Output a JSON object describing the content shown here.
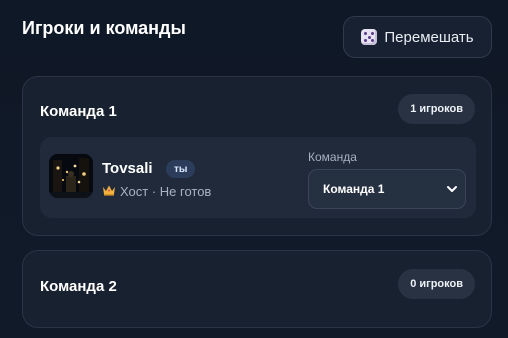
{
  "header": {
    "title": "Игроки и команды",
    "shuffle_label": "Перемешать",
    "shuffle_icon": "dice-icon"
  },
  "teams": [
    {
      "name": "Команда 1",
      "count_label": "1 игроков",
      "players": [
        {
          "name": "Tovsali",
          "you_badge": "ты",
          "status_icon": "crown-icon",
          "status": "Хост · Не готов",
          "team_field_label": "Команда",
          "team_select_value": "Команда 1"
        }
      ]
    },
    {
      "name": "Команда 2",
      "count_label": "0 игроков",
      "players": []
    }
  ],
  "colors": {
    "background": "#0f1826",
    "card": "#18212f",
    "player_row": "#202a3a",
    "badge": "#283243",
    "you_badge": "#2c3d5c"
  }
}
